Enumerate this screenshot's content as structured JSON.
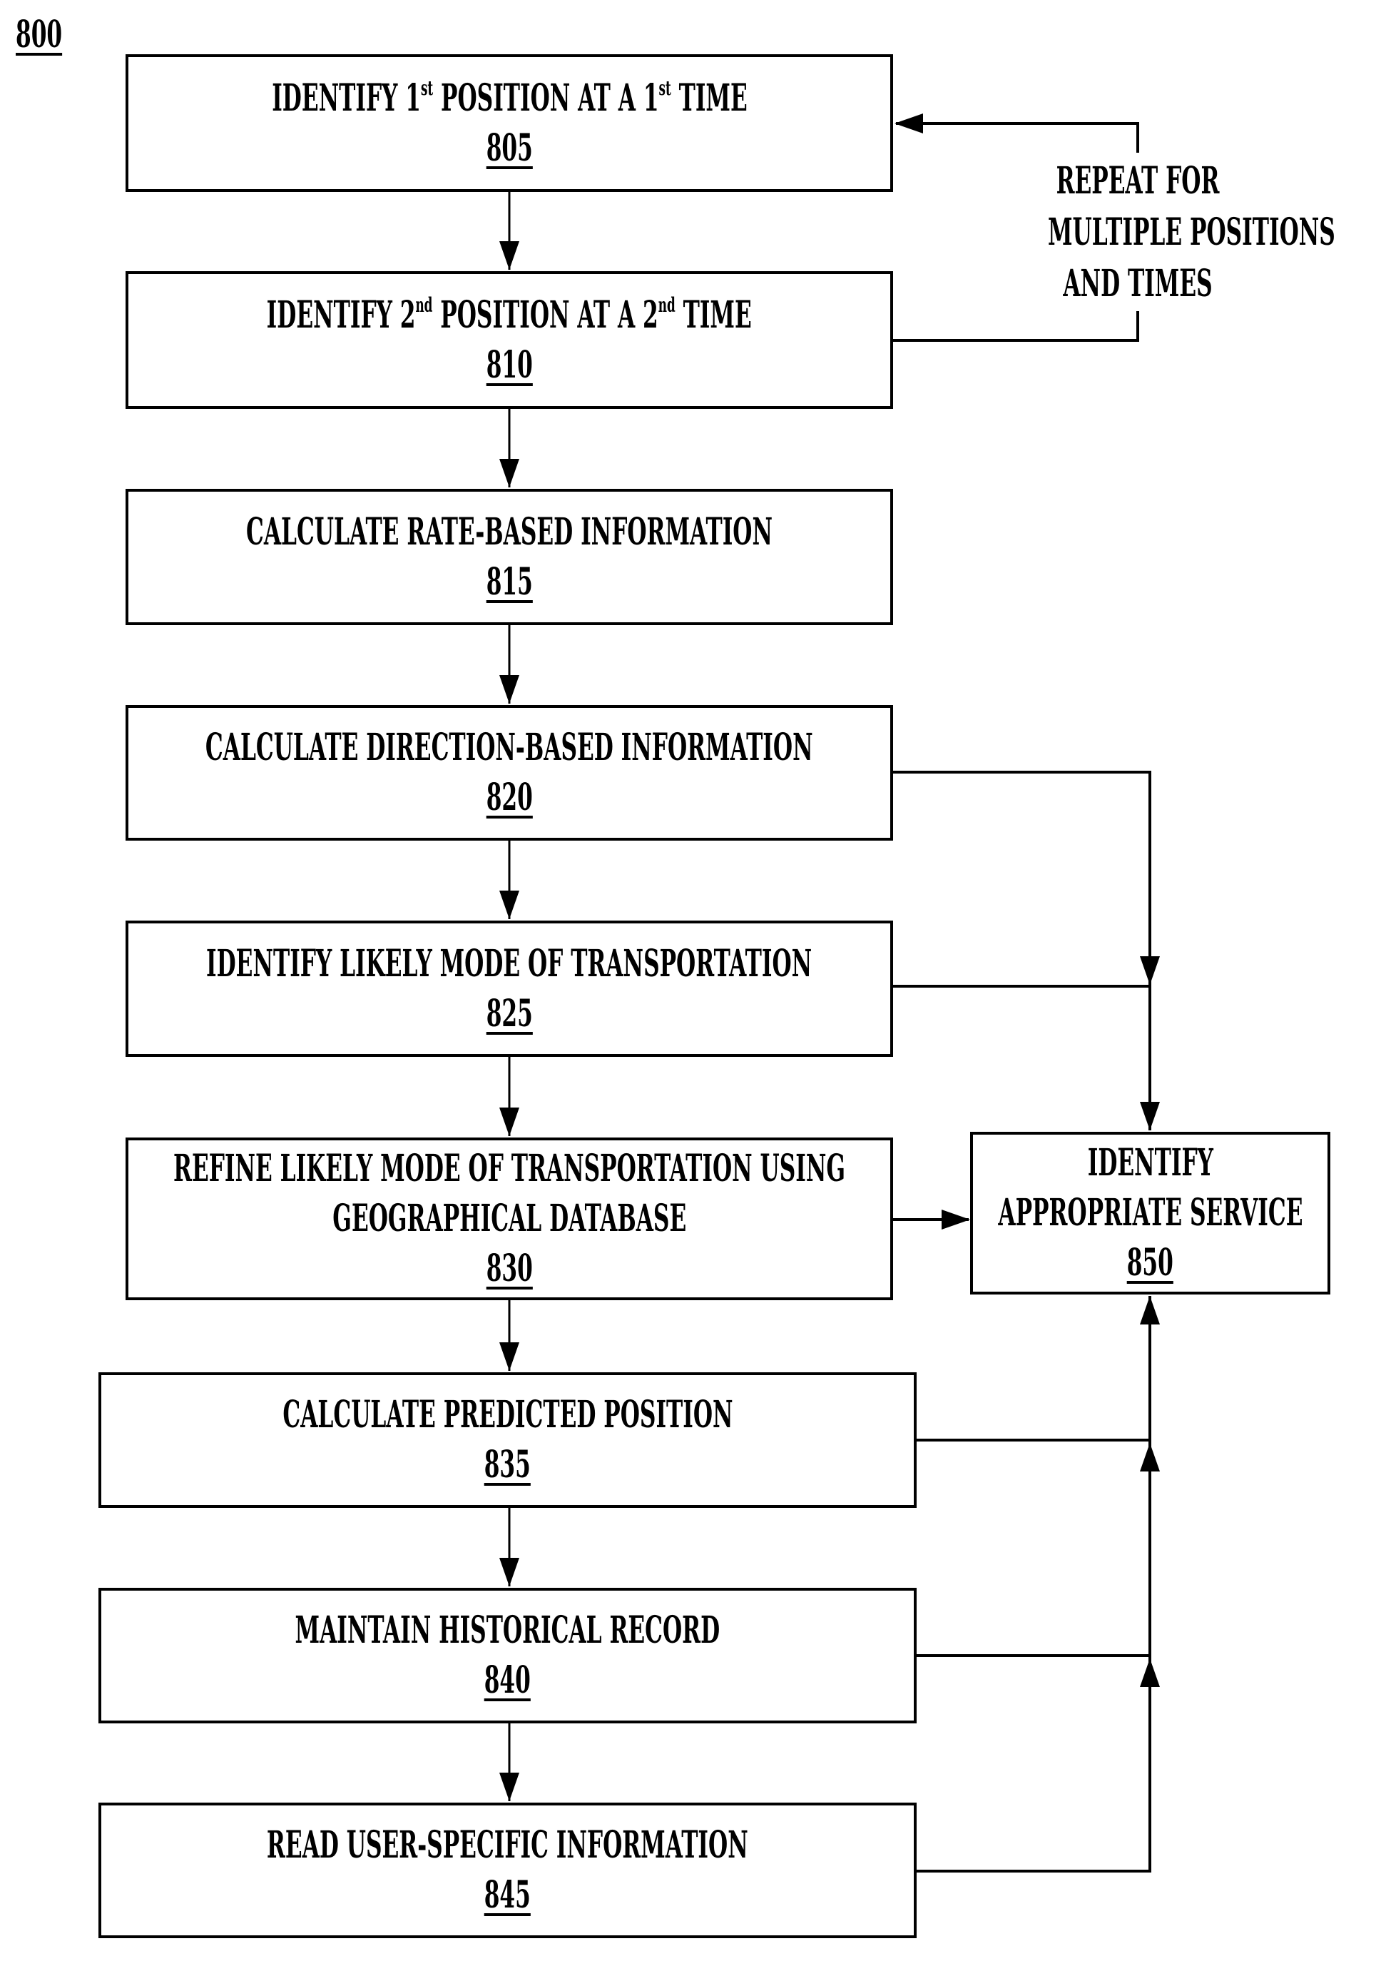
{
  "figure": {
    "label": "800"
  },
  "steps": [
    {
      "id": "805",
      "lines": [
        "IDENTIFY 1|st| POSITION AT A 1|st| TIME"
      ]
    },
    {
      "id": "810",
      "lines": [
        "IDENTIFY 2|nd| POSITION AT A 2|nd| TIME"
      ]
    },
    {
      "id": "815",
      "lines": [
        "CALCULATE RATE-BASED INFORMATION"
      ]
    },
    {
      "id": "820",
      "lines": [
        "CALCULATE DIRECTION-BASED INFORMATION"
      ]
    },
    {
      "id": "825",
      "lines": [
        "IDENTIFY LIKELY MODE OF TRANSPORTATION"
      ]
    },
    {
      "id": "830",
      "lines": [
        "REFINE LIKELY MODE OF TRANSPORTATION USING",
        "GEOGRAPHICAL DATABASE"
      ]
    },
    {
      "id": "835",
      "lines": [
        "CALCULATE PREDICTED POSITION"
      ]
    },
    {
      "id": "840",
      "lines": [
        "MAINTAIN HISTORICAL RECORD"
      ]
    },
    {
      "id": "845",
      "lines": [
        "READ USER-SPECIFIC INFORMATION"
      ]
    }
  ],
  "service": {
    "id": "850",
    "lines": [
      "IDENTIFY",
      "APPROPRIATE SERVICE"
    ]
  },
  "loop_note": {
    "lines": [
      "REPEAT FOR",
      "MULTIPLE POSITIONS",
      "AND TIMES"
    ]
  },
  "colors": {
    "ink": "#000000",
    "background": "#ffffff"
  }
}
